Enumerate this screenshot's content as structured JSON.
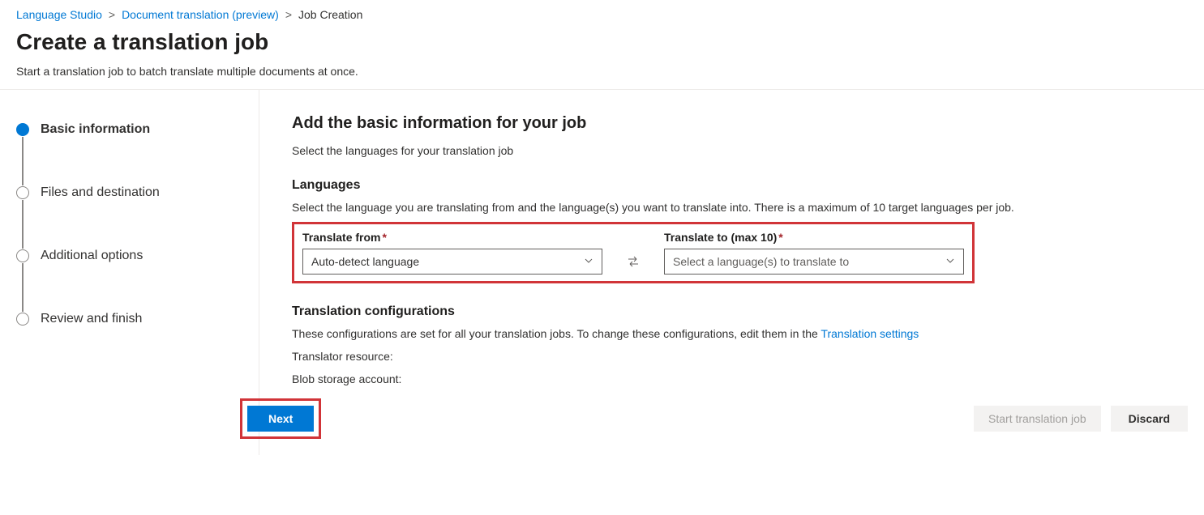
{
  "breadcrumb": {
    "items": [
      {
        "label": "Language Studio",
        "link": true
      },
      {
        "label": "Document translation (preview)",
        "link": true
      },
      {
        "label": "Job Creation",
        "link": false
      }
    ],
    "separator": ">"
  },
  "header": {
    "title": "Create a translation job",
    "subtitle": "Start a translation job to batch translate multiple documents at once."
  },
  "steps": [
    {
      "label": "Basic information",
      "active": true
    },
    {
      "label": "Files and destination",
      "active": false
    },
    {
      "label": "Additional options",
      "active": false
    },
    {
      "label": "Review and finish",
      "active": false
    }
  ],
  "main": {
    "heading": "Add the basic information for your job",
    "sub": "Select the languages for your translation job",
    "languages": {
      "title": "Languages",
      "desc": "Select the language you are translating from and the language(s) you want to translate into. There is a maximum of 10 target languages per job.",
      "from_label": "Translate from",
      "from_value": "Auto-detect language",
      "to_label": "Translate to (max 10)",
      "to_placeholder": "Select a language(s) to translate to"
    },
    "config": {
      "title": "Translation configurations",
      "desc_prefix": "These configurations are set for all your translation jobs. To change these configurations, edit them in the ",
      "desc_link": "Translation settings",
      "translator_label": "Translator resource:",
      "blob_label": "Blob storage account:"
    }
  },
  "footer": {
    "next": "Next",
    "start": "Start translation job",
    "discard": "Discard"
  }
}
